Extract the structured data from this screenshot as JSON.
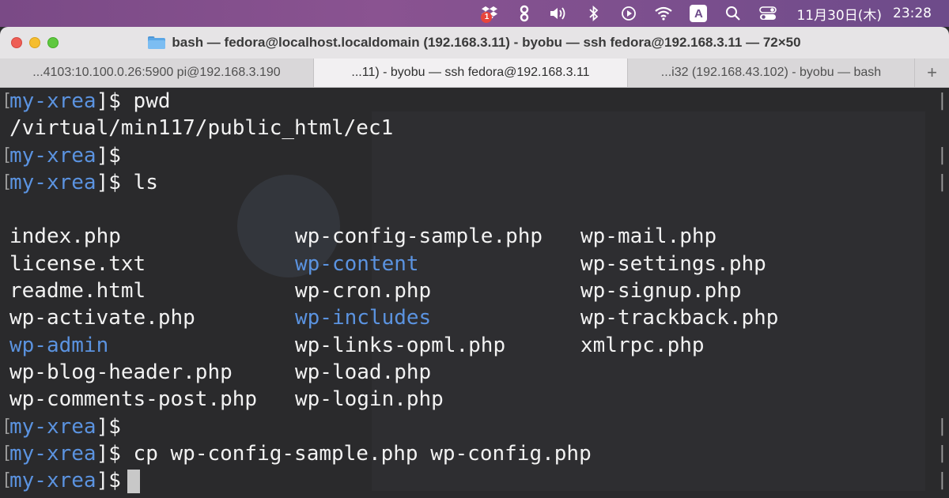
{
  "menubar": {
    "badge_count": "1",
    "ime_label": "A",
    "date": "11月30日(木)",
    "time": "23:28"
  },
  "window": {
    "title": "bash — fedora@localhost.localdomain (192.168.3.11) - byobu — ssh fedora@192.168.3.11 — 72×50"
  },
  "tabs": [
    {
      "label": "...4103:10.100.0.26:5900 pi@192.168.3.190"
    },
    {
      "label": "...11) - byobu — ssh fedora@192.168.3.11"
    },
    {
      "label": "...i32 (192.168.43.102) - byobu — bash"
    },
    {
      "label": "+"
    }
  ],
  "terminal": {
    "host_label": "my-xrea",
    "lines": [
      {
        "kind": "prompt",
        "command": "pwd"
      },
      {
        "kind": "output",
        "text": "/virtual/min117/public_html/ec1"
      },
      {
        "kind": "prompt",
        "command": ""
      },
      {
        "kind": "prompt",
        "command": "ls"
      }
    ],
    "ls_rows": [
      [
        {
          "name": "index.php",
          "dir": false
        },
        {
          "name": "wp-config-sample.php",
          "dir": false
        },
        {
          "name": "wp-mail.php",
          "dir": false
        }
      ],
      [
        {
          "name": "license.txt",
          "dir": false
        },
        {
          "name": "wp-content",
          "dir": true
        },
        {
          "name": "wp-settings.php",
          "dir": false
        }
      ],
      [
        {
          "name": "readme.html",
          "dir": false
        },
        {
          "name": "wp-cron.php",
          "dir": false
        },
        {
          "name": "wp-signup.php",
          "dir": false
        }
      ],
      [
        {
          "name": "wp-activate.php",
          "dir": false
        },
        {
          "name": "wp-includes",
          "dir": true
        },
        {
          "name": "wp-trackback.php",
          "dir": false
        }
      ],
      [
        {
          "name": "wp-admin",
          "dir": true
        },
        {
          "name": "wp-links-opml.php",
          "dir": false
        },
        {
          "name": "xmlrpc.php",
          "dir": false
        }
      ],
      [
        {
          "name": "wp-blog-header.php",
          "dir": false
        },
        {
          "name": "wp-load.php",
          "dir": false
        },
        {
          "name": "",
          "dir": false
        }
      ],
      [
        {
          "name": "wp-comments-post.php",
          "dir": false
        },
        {
          "name": "wp-login.php",
          "dir": false
        },
        {
          "name": "",
          "dir": false
        }
      ]
    ],
    "after_lines": [
      {
        "kind": "prompt",
        "command": ""
      },
      {
        "kind": "prompt",
        "command": "cp wp-config-sample.php wp-config.php"
      },
      {
        "kind": "prompt",
        "command": "",
        "cursor": true
      }
    ]
  },
  "icons": [
    "dropbox-icon",
    "evernote-icon",
    "volume-icon",
    "bluetooth-icon",
    "play-icon",
    "wifi-icon",
    "ime-icon",
    "search-icon",
    "control-center-icon",
    "folder-icon"
  ],
  "colors": {
    "host": "#5b93e0",
    "directory": "#5b93e0",
    "terminal_bg": "#2a2a2c"
  }
}
